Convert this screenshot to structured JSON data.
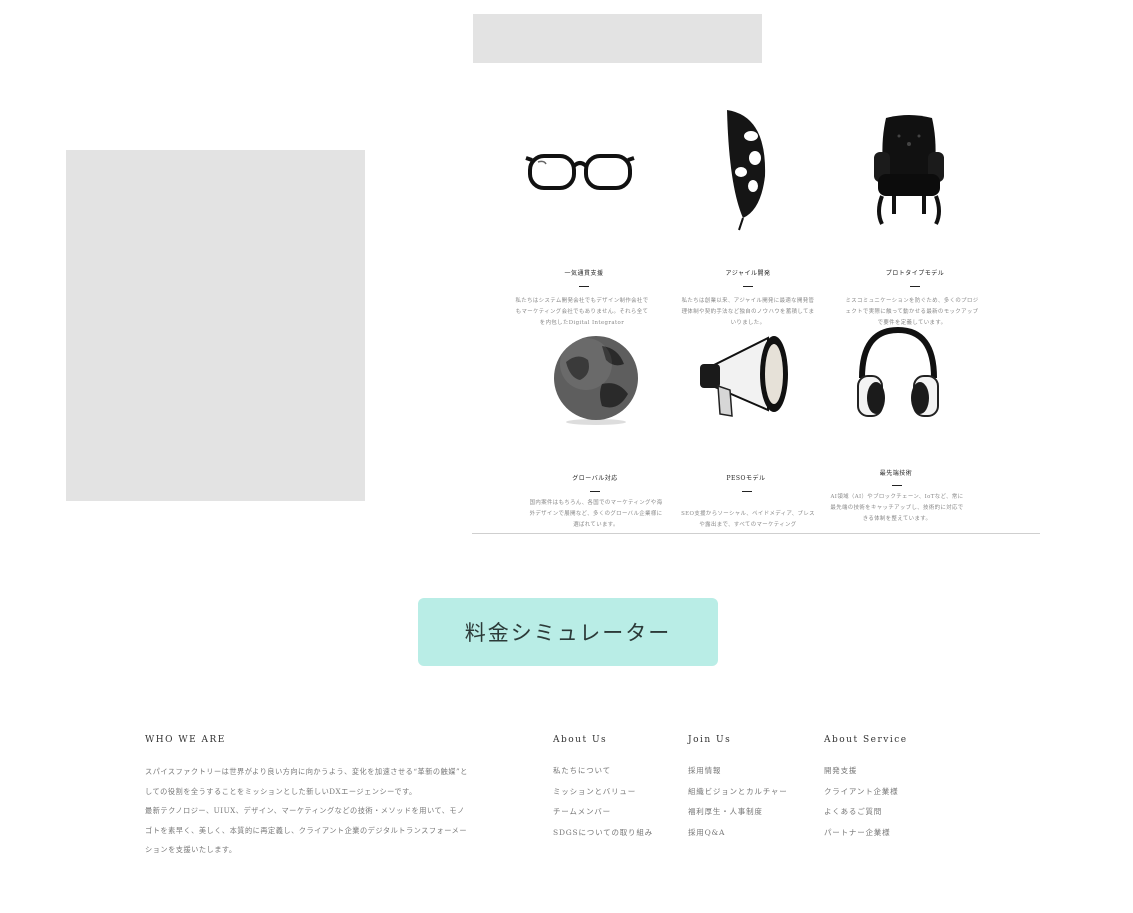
{
  "services": [
    {
      "icon": "glasses-icon",
      "title": "一気通貫支援",
      "desc": "私たちはシステム開発会社でもデザイン制作会社でもマーケティング会社でもありません。それら全てを内包したDigital Integrator"
    },
    {
      "icon": "feather-icon",
      "title": "アジャイル開発",
      "desc": "私たちは創業以来、アジャイル開発に最適な開発管理体制や契約手法など独自のノウハウを蓄積してまいりました。"
    },
    {
      "icon": "armchair-icon",
      "title": "プロトタイプモデル",
      "desc": "ミスコミュニケーションを防ぐため、多くのプロジェクトで実際に触って動かせる最新のモックアップで要件を定義しています。"
    },
    {
      "icon": "globe-icon",
      "title": "グローバル対応",
      "desc": "国内案件はもちろん、各国でのマーケティングや海外デザインで展開など、多くのグローバル企業様に選ばれています。"
    },
    {
      "icon": "megaphone-icon",
      "title": "PESOモデル",
      "desc": "SEO支援からソーシャル、ペイドメディア、プレスや露出まで、すべてのマーケティング"
    },
    {
      "icon": "headphones-icon",
      "title": "最先端技術",
      "desc": "AI領域（AI）やブロックチェーン、IoTなど、常に最先端の技術をキャッチアップし、技術的に対応できる体制を整えています。"
    }
  ],
  "simulator_button": "料金シミュレーター",
  "footer": {
    "who": {
      "heading": "WHO WE ARE",
      "paragraph1": "スパイスファクトリーは世界がより良い方向に向かうよう、変化を加速させる“革新の触媒”としての役割を全うすることをミッションとした新しいDXエージェンシーです。",
      "paragraph2": "最新テクノロジー、UIUX、デザイン、マーケティングなどの技術・メソッドを用いて、モノゴトを素早く、美しく、本質的に再定義し、クライアント企業のデジタルトランスフォーメーションを支援いたします。"
    },
    "columns": [
      {
        "heading": "About Us",
        "items": [
          "私たちについて",
          "ミッションとバリュー",
          "チームメンバー",
          "SDGSについての取り組み"
        ]
      },
      {
        "heading": "Join Us",
        "items": [
          "採用情報",
          "組織ビジョンとカルチャー",
          "福利厚生・人事制度",
          "採用Q&A"
        ]
      },
      {
        "heading": "About Service",
        "items": [
          "開発支援",
          "クライアント企業様",
          "よくあるご質問",
          "パートナー企業様"
        ]
      }
    ]
  }
}
